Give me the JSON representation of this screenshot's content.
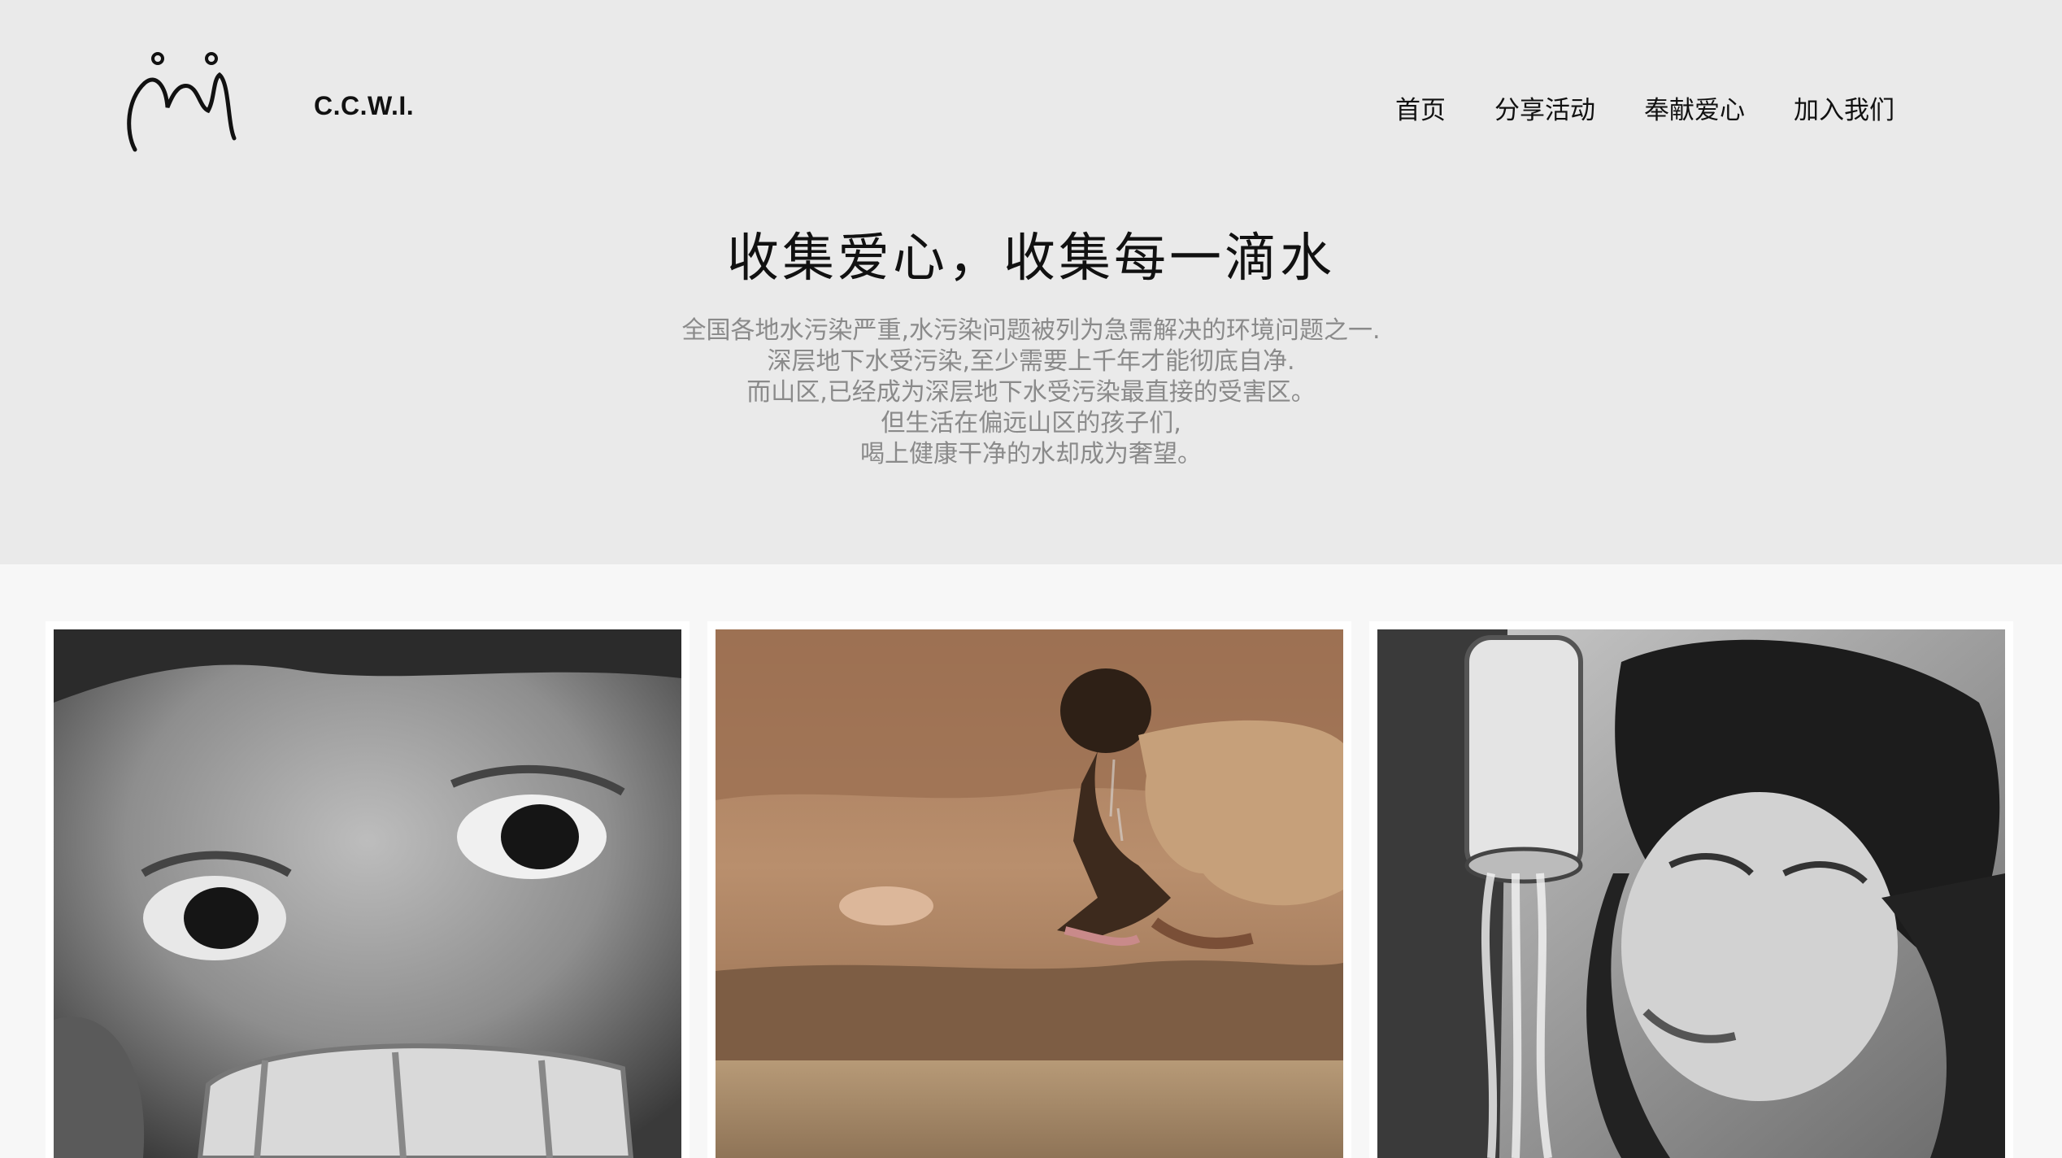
{
  "header": {
    "brand": "C.C.W.I.",
    "logo_icon": "people-logo-icon"
  },
  "nav": {
    "items": [
      {
        "label": "首页"
      },
      {
        "label": "分享活动"
      },
      {
        "label": "奉献爱心"
      },
      {
        "label": "加入我们"
      }
    ]
  },
  "hero": {
    "title": "收集爱心，收集每一滴水",
    "lines": [
      "全国各地水污染严重,水污染问题被列为急需解决的环境问题之一.",
      "深层地下水受污染,至少需要上千年才能彻底自净.",
      "而山区,已经成为深层地下水受污染最直接的受害区。",
      "但生活在偏远山区的孩子们,",
      "喝上健康干净的水却成为奢望。"
    ]
  },
  "gallery": {
    "photos": [
      {
        "subject": "child-drinking-from-cup-bw"
      },
      {
        "subject": "boy-drinking-from-muddy-water"
      },
      {
        "subject": "girl-drinking-from-pipe-bw"
      }
    ]
  },
  "colors": {
    "hero_bg": "#eaeaea",
    "page_bg": "#f7f7f7",
    "text_dark": "#111111",
    "text_muted": "#8a8a8a"
  }
}
